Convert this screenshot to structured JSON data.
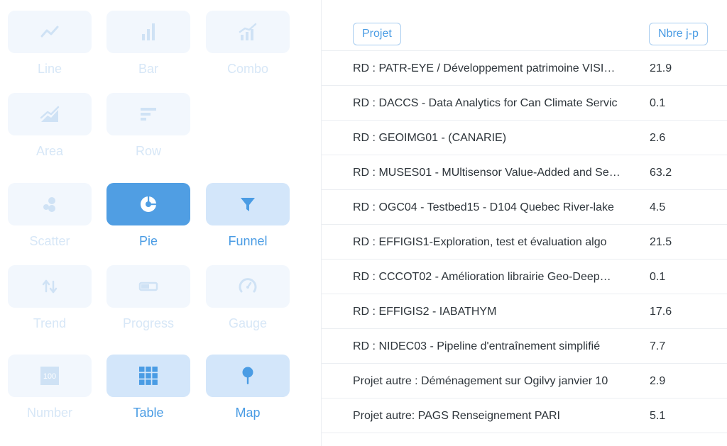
{
  "picker": {
    "items": [
      {
        "label": "Line",
        "icon": "line-chart-icon",
        "state": "disabled"
      },
      {
        "label": "Bar",
        "icon": "bar-chart-icon",
        "state": "disabled"
      },
      {
        "label": "Combo",
        "icon": "combo-chart-icon",
        "state": "disabled"
      },
      {
        "label": "Area",
        "icon": "area-chart-icon",
        "state": "disabled"
      },
      {
        "label": "Row",
        "icon": "row-chart-icon",
        "state": "disabled"
      },
      {
        "label": "Scatter",
        "icon": "scatter-icon",
        "state": "disabled"
      },
      {
        "label": "Pie",
        "icon": "pie-icon",
        "state": "selected"
      },
      {
        "label": "Funnel",
        "icon": "funnel-icon",
        "state": "sensible"
      },
      {
        "label": "Trend",
        "icon": "trend-icon",
        "state": "disabled"
      },
      {
        "label": "Progress",
        "icon": "progress-icon",
        "state": "disabled"
      },
      {
        "label": "Gauge",
        "icon": "gauge-icon",
        "state": "disabled"
      },
      {
        "label": "Number",
        "icon": "number-icon",
        "icon_text": "100",
        "state": "disabled"
      },
      {
        "label": "Table",
        "icon": "table-icon",
        "state": "sensible"
      },
      {
        "label": "Map",
        "icon": "map-pin-icon",
        "state": "sensible"
      }
    ]
  },
  "table": {
    "headers": [
      "Projet",
      "Nbre j-p"
    ],
    "rows": [
      [
        "RD : PATR-EYE / Développement patrimoine VISI…",
        "21.9"
      ],
      [
        "RD : DACCS - Data Analytics for Can Climate Servic",
        "0.1"
      ],
      [
        "RD : GEOIMG01 - (CANARIE)",
        "2.6"
      ],
      [
        "RD : MUSES01 - MUltisensor Value-Added and Se…",
        "63.2"
      ],
      [
        "RD : OGC04 - Testbed15 - D104 Quebec River-lake",
        "4.5"
      ],
      [
        "RD : EFFIGIS1-Exploration, test et évaluation algo",
        "21.5"
      ],
      [
        "RD : CCCOT02 - Amélioration librairie Geo-Deep…",
        "0.1"
      ],
      [
        "RD : EFFIGIS2 - IABATHYM",
        "17.6"
      ],
      [
        "RD : NIDEC03 - Pipeline d'entraînement simplifié",
        "7.7"
      ],
      [
        "Projet autre : Déménagement sur Ogilvy janvier 10",
        "2.9"
      ],
      [
        "Projet autre: PAGS Renseignement PARI",
        "5.1"
      ]
    ]
  },
  "colors": {
    "accent": "#509ee3",
    "accent_text": "#4a9ce4",
    "tile_disabled": "#f2f7fd",
    "tile_sensible": "#d3e6fa",
    "label_disabled": "#d7e7f7",
    "icon_disabled": "#cfe2f5"
  }
}
